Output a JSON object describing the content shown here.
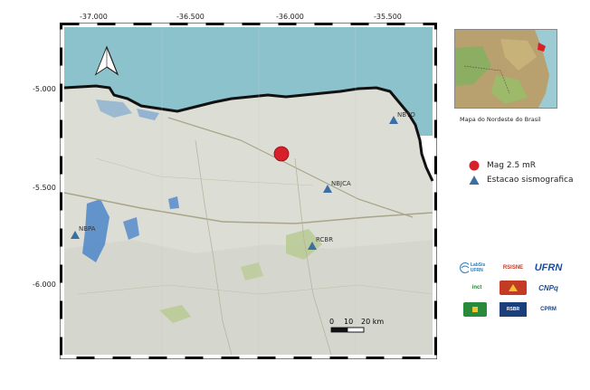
{
  "map": {
    "lon_ticks": [
      "-37.000",
      "-36.500",
      "-36.000",
      "-35.500"
    ],
    "lat_ticks": [
      "-5.000",
      "-5.500",
      "-6.000"
    ],
    "stations": [
      {
        "code": "NBTO"
      },
      {
        "code": "NBJCA"
      },
      {
        "code": "NBPA"
      },
      {
        "code": "RCBR"
      }
    ],
    "event_marker": {
      "color": "#d8202a"
    },
    "north_arrow": "north-arrow-icon",
    "scale_bar": {
      "labels": [
        "0",
        "10",
        "20 km"
      ]
    }
  },
  "inset": {
    "caption": "Mapa do Nordeste do Brasil"
  },
  "legend": {
    "items": [
      {
        "label": "Mag 2.5 mR",
        "symbol": "red-circle-icon",
        "color": "#d8202a"
      },
      {
        "label": "Estacao sismografica",
        "symbol": "blue-triangle-icon",
        "color": "#3a6fa5"
      }
    ]
  },
  "logos": {
    "row1": [
      "LabSis UFRN",
      "RSISNE",
      "UFRN"
    ],
    "row2": [
      "inct",
      "",
      "CNPq"
    ],
    "row3": [
      "",
      "RSBR",
      "CPRM"
    ]
  },
  "colors": {
    "sea": "#8cc2cc",
    "land": "#ddded6",
    "coast": "#111111",
    "station": "#3a6fa5"
  }
}
